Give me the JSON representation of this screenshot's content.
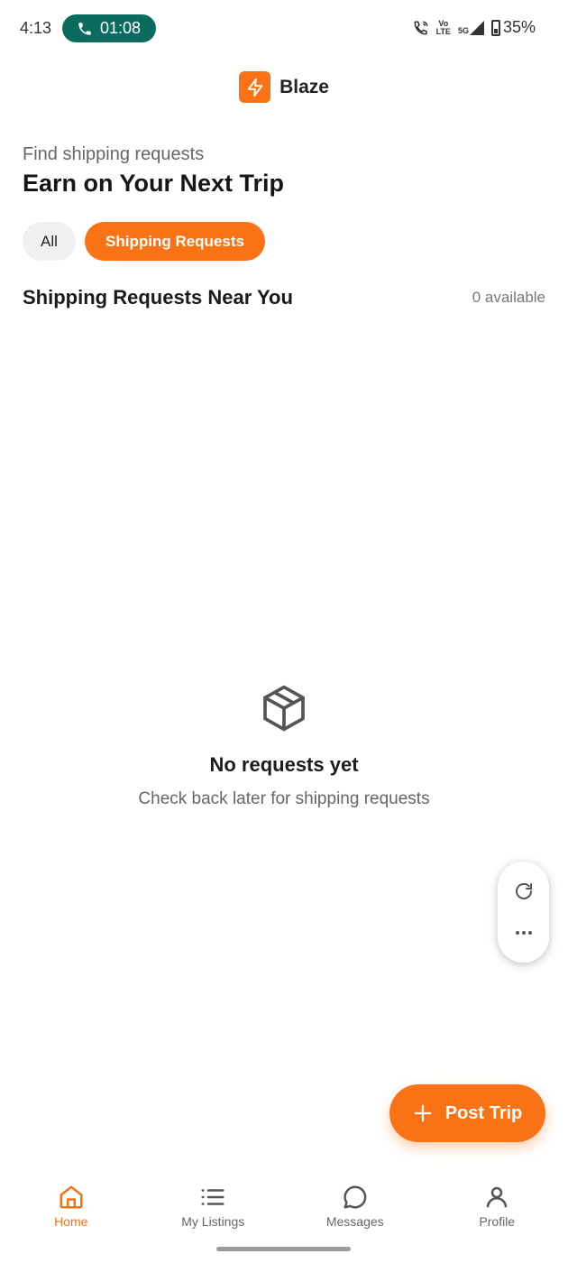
{
  "status_bar": {
    "time": "4:13",
    "call_timer": "01:08",
    "network_top": "Vo",
    "network_bottom": "LTE",
    "network_type": "5G",
    "battery": "35%"
  },
  "app": {
    "name": "Blaze",
    "brand_color": "#f97316",
    "call_color": "#0b6b5f"
  },
  "header": {
    "eyebrow": "Find shipping requests",
    "title": "Earn on Your Next Trip"
  },
  "filters": {
    "all_label": "All",
    "active_label": "Shipping Requests"
  },
  "section": {
    "title": "Shipping Requests Near You",
    "count": "0 available"
  },
  "empty_state": {
    "icon": "package-icon",
    "title": "No requests yet",
    "subtitle": "Check back later for shipping requests"
  },
  "side_panel": {
    "refresh_icon": "refresh-icon",
    "more_icon": "more-icon"
  },
  "fab": {
    "label": "Post Trip",
    "icon": "plus-icon"
  },
  "bottom_nav": {
    "items": [
      {
        "label": "Home",
        "icon": "home-icon",
        "active": true
      },
      {
        "label": "My Listings",
        "icon": "list-icon",
        "active": false
      },
      {
        "label": "Messages",
        "icon": "chat-icon",
        "active": false
      },
      {
        "label": "Profile",
        "icon": "user-icon",
        "active": false
      }
    ]
  }
}
